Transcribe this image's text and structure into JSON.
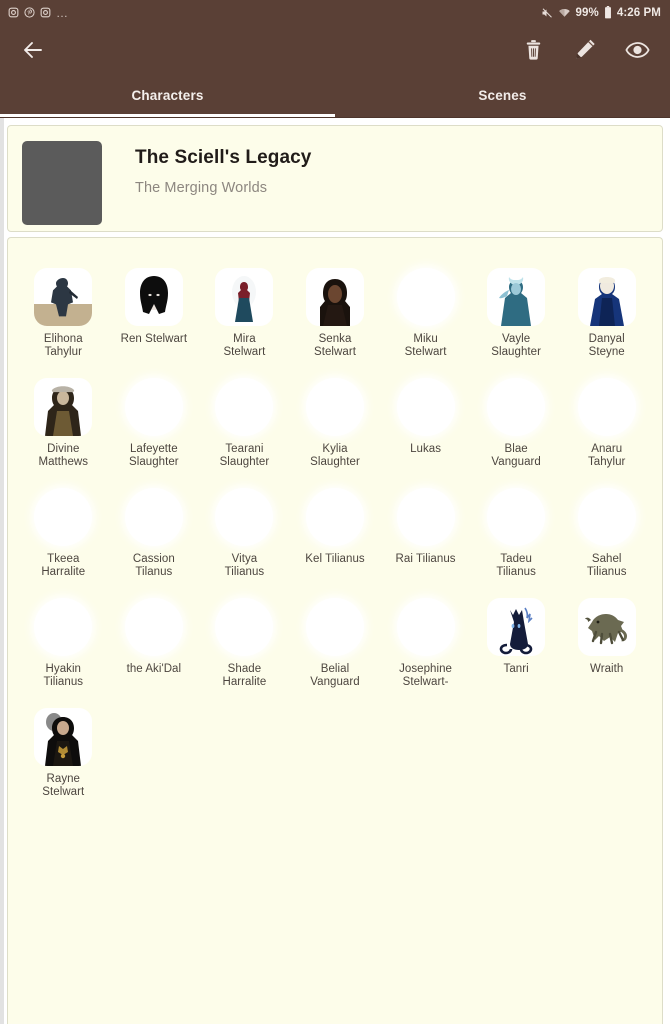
{
  "theme": {
    "toolbar_color": "#5a4036",
    "content_color": "#fdfdea",
    "accent_color": "#ffffff",
    "label_color": "#4c453f",
    "thumb_color": "#5b5b5b"
  },
  "statusbar": {
    "left_icons": [
      "instagram-icon",
      "pinterest-icon",
      "instagram-icon"
    ],
    "overflow": "…",
    "mute_icon": "mute-icon",
    "wifi_icon": "wifi-icon",
    "battery_percent": "99%",
    "battery_icon": "battery-icon",
    "clock": "4:26 PM"
  },
  "actionbar": {
    "back_icon": "back-arrow-icon",
    "actions": [
      {
        "name": "delete-button",
        "icon": "trash-icon"
      },
      {
        "name": "edit-button",
        "icon": "pencil-icon"
      },
      {
        "name": "view-button",
        "icon": "eye-icon"
      }
    ]
  },
  "tabs": {
    "items": [
      {
        "label": "Characters",
        "selected": true
      },
      {
        "label": "Scenes",
        "selected": false
      }
    ]
  },
  "header": {
    "title": "The Sciell's Legacy",
    "subtitle": "The Merging Worlds",
    "thumbnail": "story-cover-placeholder"
  },
  "characters": [
    {
      "name": "Elihona\nTahylur",
      "art": "elihona"
    },
    {
      "name": "Ren Stelwart",
      "art": "ren"
    },
    {
      "name": "Mira\nStelwart",
      "art": "mira"
    },
    {
      "name": "Senka\nStelwart",
      "art": "senka"
    },
    {
      "name": "Miku\nStelwart",
      "art": null
    },
    {
      "name": "Vayle\nSlaughter",
      "art": "vayle"
    },
    {
      "name": "Danyal\nSteyne",
      "art": "danyal"
    },
    {
      "name": "Divine\nMatthews",
      "art": "divine"
    },
    {
      "name": "Lafeyette\nSlaughter",
      "art": null
    },
    {
      "name": "Tearani\nSlaughter",
      "art": null
    },
    {
      "name": "Kylia\nSlaughter",
      "art": null
    },
    {
      "name": "Lukas",
      "art": null
    },
    {
      "name": "Blae\nVanguard",
      "art": null
    },
    {
      "name": "Anaru\nTahylur",
      "art": null
    },
    {
      "name": "Tkeea\nHarralite",
      "art": null
    },
    {
      "name": "Cassion\nTilanus",
      "art": null
    },
    {
      "name": "Vitya\nTilianus",
      "art": null
    },
    {
      "name": "Kel Tilianus",
      "art": null
    },
    {
      "name": "Rai Tilianus",
      "art": null
    },
    {
      "name": "Tadeu\nTilianus",
      "art": null
    },
    {
      "name": "Sahel\nTilianus",
      "art": null
    },
    {
      "name": "Hyakin\nTilianus",
      "art": null
    },
    {
      "name": "the Aki'Dal",
      "art": null
    },
    {
      "name": "Shade\nHarralite",
      "art": null
    },
    {
      "name": "Belial\nVanguard",
      "art": null
    },
    {
      "name": "Josephine\nStelwart-",
      "art": null
    },
    {
      "name": "Tanri",
      "art": "tanri"
    },
    {
      "name": "Wraith",
      "art": "wraith"
    },
    {
      "name": "Rayne\nStelwart",
      "art": "rayne"
    }
  ]
}
